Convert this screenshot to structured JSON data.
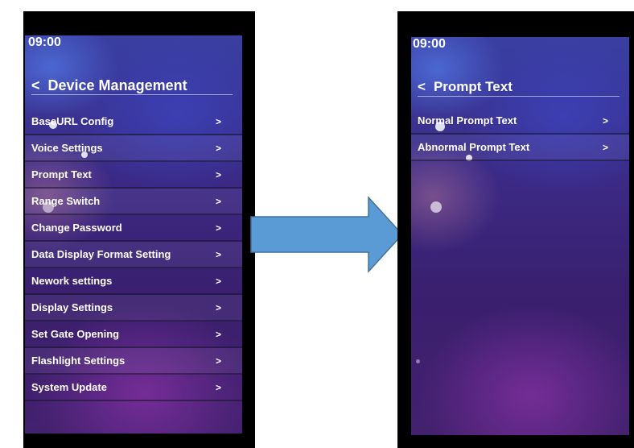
{
  "left": {
    "time": "09:00",
    "back_glyph": "<",
    "title": "Device Management",
    "items": [
      {
        "label": "BaseURL Config",
        "chevron": ">"
      },
      {
        "label": "Voice Settings",
        "chevron": ">"
      },
      {
        "label": "Prompt Text",
        "chevron": ">"
      },
      {
        "label": "Range Switch",
        "chevron": ">"
      },
      {
        "label": "Change Password",
        "chevron": ">"
      },
      {
        "label": "Data Display Format Setting",
        "chevron": ">"
      },
      {
        "label": "Nework settings",
        "chevron": ">"
      },
      {
        "label": "Display Settings",
        "chevron": ">"
      },
      {
        "label": "Set Gate Opening",
        "chevron": ">"
      },
      {
        "label": "Flashlight Settings",
        "chevron": ">"
      },
      {
        "label": "System Update",
        "chevron": ">"
      }
    ]
  },
  "right": {
    "time": "09:00",
    "back_glyph": "<",
    "title": "Prompt Text",
    "items": [
      {
        "label": "Normal Prompt Text",
        "chevron": ">"
      },
      {
        "label": "Abnormal Prompt Text",
        "chevron": ">"
      }
    ]
  },
  "colors": {
    "arrow_fill": "#5b9bd5",
    "arrow_stroke": "#41719c",
    "frame": "#000000"
  },
  "icons": {
    "transition": "right-arrow-icon",
    "back": "chevron-left-icon",
    "item": "chevron-right-icon"
  }
}
